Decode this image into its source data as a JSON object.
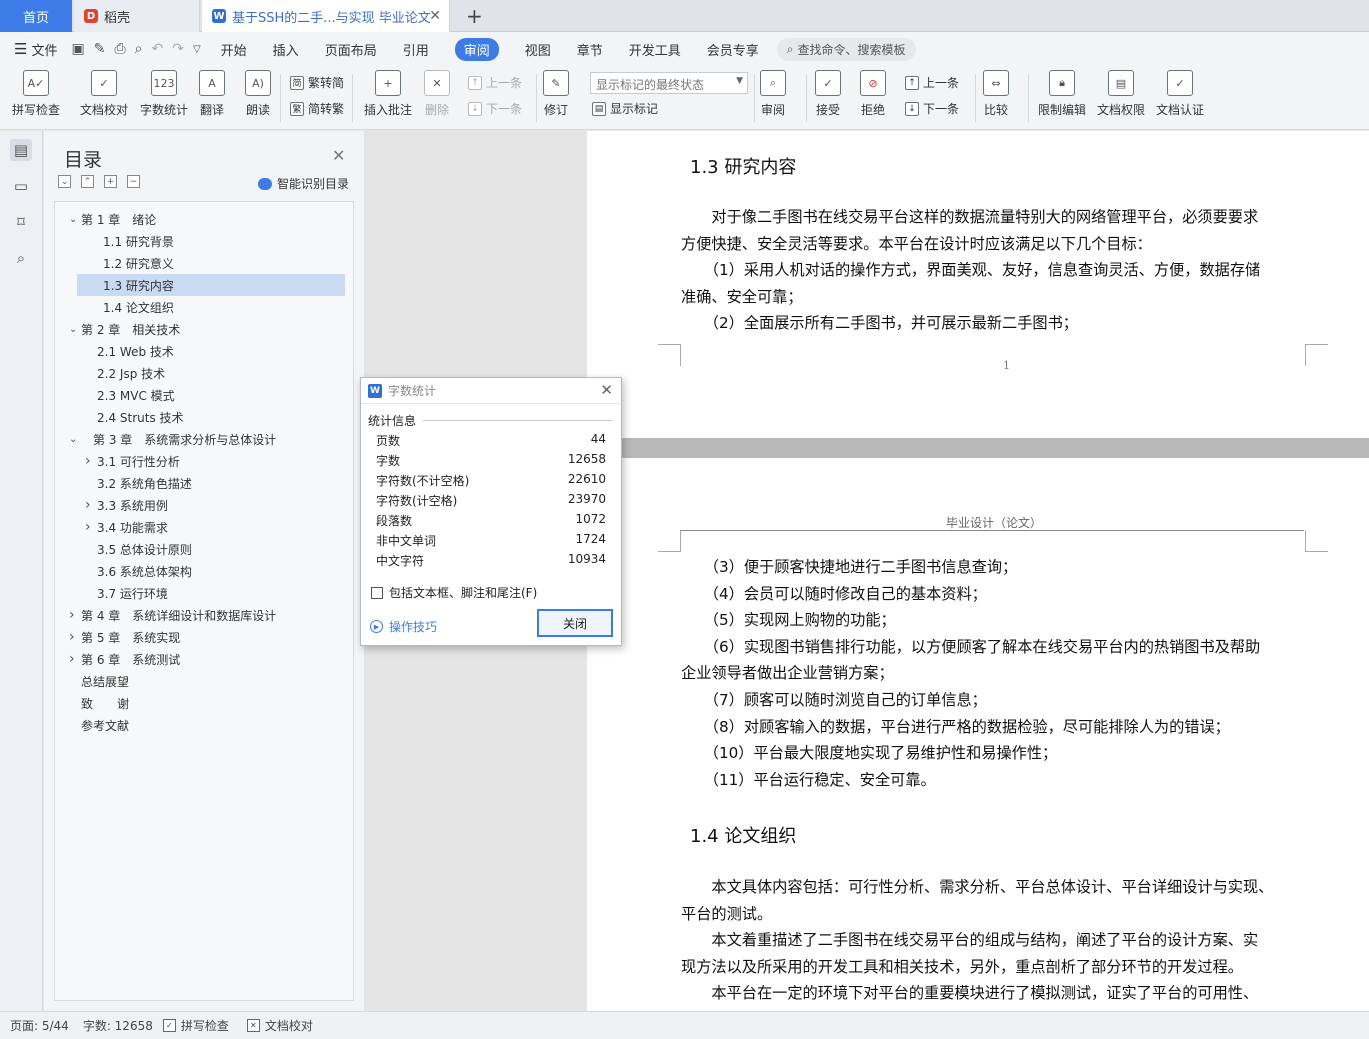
{
  "tabs": {
    "home": "首页",
    "docke": "稻壳",
    "doc": "基于SSH的二手...与实现 毕业论文",
    "add": "+"
  },
  "menu": {
    "file": "文件",
    "items": [
      "开始",
      "插入",
      "页面布局",
      "引用",
      "审阅",
      "视图",
      "章节",
      "开发工具",
      "会员专享"
    ],
    "active": "审阅",
    "search": "查找命令、搜索模板"
  },
  "ribbon": {
    "spell": "拼写检查",
    "proof": "文档校对",
    "wordcount": "字数统计",
    "translate": "翻译",
    "read": "朗读",
    "trad": "繁转简",
    "simp": "简转繁",
    "insert_comment": "插入批注",
    "delete": "删除",
    "prev_comment": "上一条",
    "next_comment": "下一条",
    "revise": "修订",
    "markup_state": "显示标记的最终状态",
    "show_markup": "显示标记",
    "review": "审阅",
    "accept": "接受",
    "reject": "拒绝",
    "prev": "上一条",
    "next": "下一条",
    "compare": "比较",
    "restrict": "限制编辑",
    "rights": "文档权限",
    "certify": "文档认证"
  },
  "toc": {
    "title": "目录",
    "smart": "智能识别目录",
    "items": [
      {
        "text": "第 1 章　绪论",
        "level": 0,
        "arrow": "open"
      },
      {
        "text": "1.1  研究背景",
        "level": 2,
        "arrow": ""
      },
      {
        "text": "1.2  研究意义",
        "level": 2,
        "arrow": ""
      },
      {
        "text": "1.3  研究内容",
        "level": 2,
        "arrow": "",
        "selected": true
      },
      {
        "text": "1.4  论文组织",
        "level": 2,
        "arrow": ""
      },
      {
        "text": "第 2 章　相关技术",
        "level": 0,
        "arrow": "open"
      },
      {
        "text": "2.1 Web 技术",
        "level": 1,
        "arrow": ""
      },
      {
        "text": "2.2 Jsp 技术",
        "level": 1,
        "arrow": ""
      },
      {
        "text": "2.3 MVC 模式",
        "level": 1,
        "arrow": ""
      },
      {
        "text": "2.4 Struts 技术",
        "level": 1,
        "arrow": ""
      },
      {
        "text": "第 3 章　系统需求分析与总体设计",
        "level": 5,
        "arrow": "open"
      },
      {
        "text": "3.1  可行性分析",
        "level": 1,
        "arrow": "closed"
      },
      {
        "text": "3.2  系统角色描述",
        "level": 1,
        "arrow": ""
      },
      {
        "text": "3.3  系统用例",
        "level": 1,
        "arrow": "closed"
      },
      {
        "text": "3.4  功能需求",
        "level": 1,
        "arrow": "closed"
      },
      {
        "text": "3.5  总体设计原则",
        "level": 1,
        "arrow": ""
      },
      {
        "text": "3.6  系统总体架构",
        "level": 1,
        "arrow": ""
      },
      {
        "text": "3.7  运行环境",
        "level": 1,
        "arrow": ""
      },
      {
        "text": "第 4 章　系统详细设计和数据库设计",
        "level": 0,
        "arrow": "closed"
      },
      {
        "text": "第 5 章　系统实现",
        "level": 0,
        "arrow": "closed"
      },
      {
        "text": "第 6 章　系统测试",
        "level": 0,
        "arrow": "closed"
      },
      {
        "text": "总结展望",
        "level": 0,
        "arrow": ""
      },
      {
        "text": "致　　谢",
        "level": 0,
        "arrow": ""
      },
      {
        "text": "参考文献",
        "level": 0,
        "arrow": ""
      }
    ]
  },
  "document": {
    "h13": "1.3  研究内容",
    "p1_lines": [
      "　　对于像二手图书在线交易平台这样的数据流量特别大的网络管理平台，必须要要求",
      "方便快捷、安全灵活等要求。本平台在设计时应该满足以下几个目标：",
      "　　（1）采用人机对话的操作方式，界面美观、友好，信息查询灵活、方便，数据存储",
      "准确、安全可靠；",
      "　　（2）全面展示所有二手图书，并可展示最新二手图书；"
    ],
    "page_number": "1",
    "page2_header": "毕业设计（论文）",
    "p2_lines": [
      "　　（3）便于顾客快捷地进行二手图书信息查询；",
      "　　（4）会员可以随时修改自己的基本资料；",
      "　　（5）实现网上购物的功能；",
      "　　（6）实现图书销售排行功能，以方便顾客了解本在线交易平台内的热销图书及帮助",
      "企业领导者做出企业营销方案；",
      "　　（7）顾客可以随时浏览自己的订单信息；",
      "　　（8）对顾客输入的数据，平台进行严格的数据检验，尽可能排除人为的错误；",
      "　　（10）平台最大限度地实现了易维护性和易操作性；",
      "　　（11）平台运行稳定、安全可靠。"
    ],
    "h14": "1.4  论文组织",
    "p3_lines": [
      "　　本文具体内容包括：可行性分析、需求分析、平台总体设计、平台详细设计与实现、",
      "平台的测试。",
      "　　本文着重描述了二手图书在线交易平台的组成与结构，阐述了平台的设计方案、实",
      "现方法以及所采用的开发工具和相关技术，另外，重点剖析了部分环节的开发过程。",
      "　　本平台在一定的环境下对平台的重要模块进行了模拟测试，证实了平台的可用性、"
    ]
  },
  "dialog": {
    "title": "字数统计",
    "section": "统计信息",
    "rows": [
      {
        "k": "页数",
        "v": "44"
      },
      {
        "k": "字数",
        "v": "12658"
      },
      {
        "k": "字符数(不计空格)",
        "v": "22610"
      },
      {
        "k": "字符数(计空格)",
        "v": "23970"
      },
      {
        "k": "段落数",
        "v": "1072"
      },
      {
        "k": "非中文单词",
        "v": "1724"
      },
      {
        "k": "中文字符",
        "v": "10934"
      }
    ],
    "checkbox": "包括文本框、脚注和尾注(F)",
    "tips": "操作技巧",
    "close": "关闭"
  },
  "status": {
    "page": "页面: 5/44",
    "words": "字数: 12658",
    "spell": "拼写检查",
    "proof": "文档校对"
  }
}
